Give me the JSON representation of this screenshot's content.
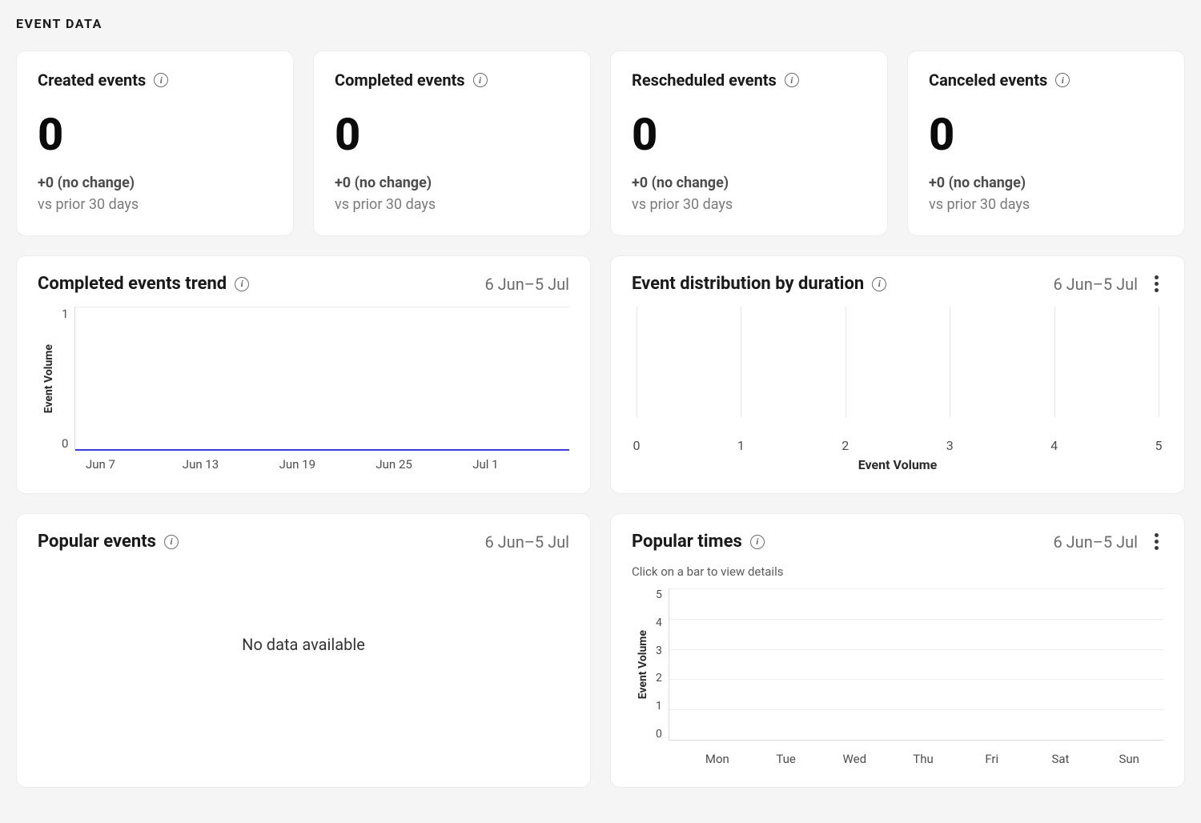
{
  "section_title": "EVENT DATA",
  "date_range": "6 Jun–5 Jul",
  "stats": [
    {
      "title": "Created events",
      "value": "0",
      "delta": "+0 (no change)",
      "compare": "vs prior 30 days"
    },
    {
      "title": "Completed events",
      "value": "0",
      "delta": "+0 (no change)",
      "compare": "vs prior 30 days"
    },
    {
      "title": "Rescheduled events",
      "value": "0",
      "delta": "+0 (no change)",
      "compare": "vs prior 30 days"
    },
    {
      "title": "Canceled events",
      "value": "0",
      "delta": "+0 (no change)",
      "compare": "vs prior 30 days"
    }
  ],
  "charts": {
    "trend": {
      "title": "Completed events trend",
      "range": "6 Jun–5 Jul",
      "y_label": "Event Volume"
    },
    "distribution": {
      "title": "Event distribution by duration",
      "range": "6 Jun–5 Jul",
      "x_label": "Event Volume"
    },
    "popular_events": {
      "title": "Popular events",
      "range": "6 Jun–5 Jul",
      "empty": "No data available"
    },
    "popular_times": {
      "title": "Popular times",
      "range": "6 Jun–5 Jul",
      "subtitle": "Click on a bar to view details",
      "y_label": "Event Volume"
    }
  },
  "chart_data": [
    {
      "id": "completed_events_trend",
      "type": "line",
      "title": "Completed events trend",
      "xlabel": "",
      "ylabel": "Event Volume",
      "ylim": [
        0,
        1
      ],
      "x_ticks": [
        "Jun 7",
        "Jun 13",
        "Jun 19",
        "Jun 25",
        "Jul 1"
      ],
      "y_ticks": [
        0,
        1
      ],
      "series": [
        {
          "name": "Completed events",
          "values": [
            0,
            0,
            0,
            0,
            0
          ]
        }
      ]
    },
    {
      "id": "event_distribution_by_duration",
      "type": "bar",
      "title": "Event distribution by duration",
      "xlabel": "Event Volume",
      "ylabel": "",
      "xlim": [
        0,
        5
      ],
      "x_ticks": [
        0,
        1,
        2,
        3,
        4,
        5
      ],
      "categories": [],
      "values": []
    },
    {
      "id": "popular_times",
      "type": "bar",
      "title": "Popular times",
      "xlabel": "",
      "ylabel": "Event Volume",
      "ylim": [
        0,
        5
      ],
      "y_ticks": [
        0,
        1,
        2,
        3,
        4,
        5
      ],
      "categories": [
        "Mon",
        "Tue",
        "Wed",
        "Thu",
        "Fri",
        "Sat",
        "Sun"
      ],
      "values": [
        0,
        0,
        0,
        0,
        0,
        0,
        0
      ]
    }
  ]
}
